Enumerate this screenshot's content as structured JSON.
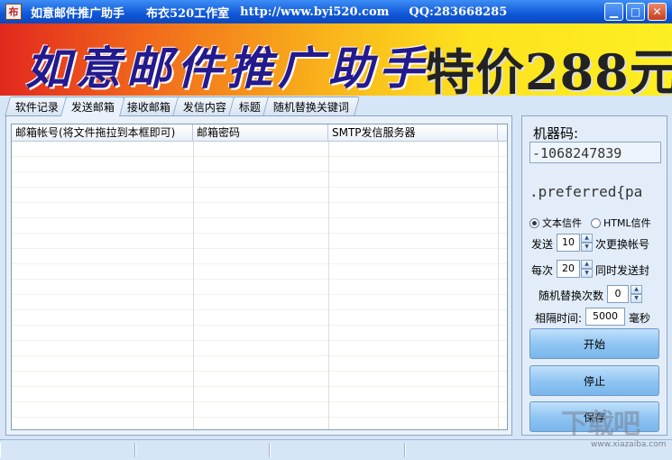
{
  "window": {
    "icon_glyph": "布",
    "title": "如意邮件推广助手",
    "studio": "布衣520工作室",
    "url": "http://www.byi520.com",
    "qq": "QQ:283668285",
    "min": "▁",
    "max": "□",
    "close": "✕"
  },
  "banner": {
    "title": "如意邮件推广助手",
    "price": "特价288元"
  },
  "tabs": [
    "软件记录",
    "发送邮箱",
    "接收邮箱",
    "发信内容",
    "标题",
    "随机替换关键词"
  ],
  "grid": {
    "columns": [
      "邮箱帐号(将文件拖拉到本框即可)",
      "邮箱密码",
      "SMTP发信服务器"
    ]
  },
  "side": {
    "machine_label": "机器码:",
    "machine_code": "-1068247839",
    "preferred": ".preferred{pa",
    "radio_text": "文本信件",
    "radio_html": "HTML信件",
    "send_prefix": "发送",
    "send_value": "10",
    "send_suffix": "次更换帐号",
    "each_prefix": "每次",
    "each_value": "20",
    "each_suffix": "同时发送封",
    "random_label": "随机替换次数",
    "random_value": "0",
    "interval_label": "相隔时间:",
    "interval_value": "5000",
    "interval_unit": "毫秒",
    "start": "开始",
    "stop": "停止",
    "save": "保存"
  },
  "watermark": {
    "main": "下载吧",
    "sub": "www.xiazaiba.com"
  }
}
